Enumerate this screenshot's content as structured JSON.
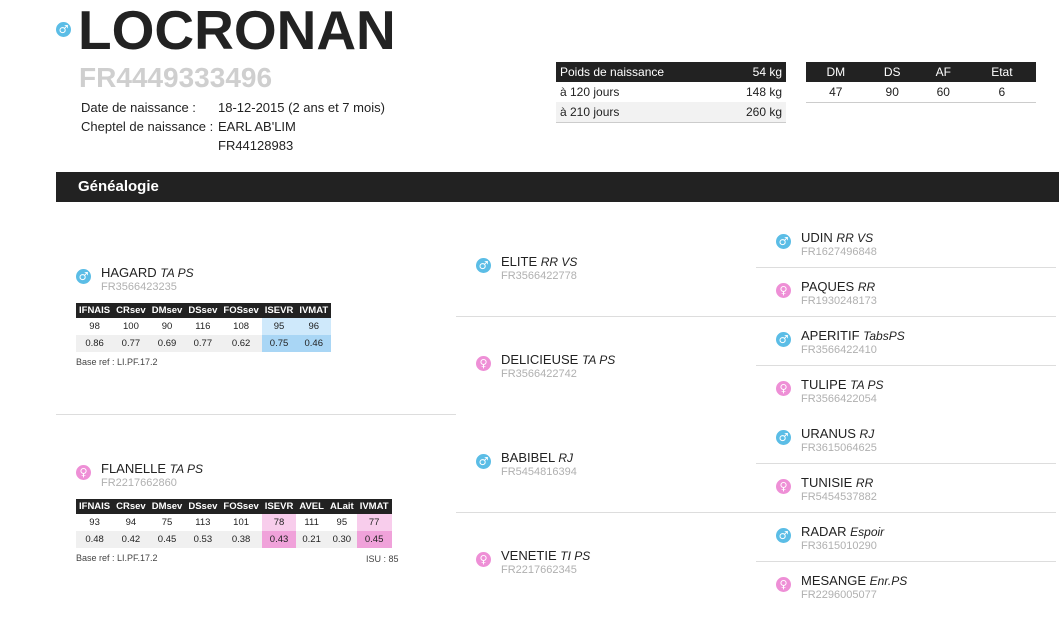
{
  "animal": {
    "sex_icon": "male-icon",
    "name": "LOCRONAN",
    "id": "FR4449333496",
    "birth_date_label": "Date de naissance :",
    "birth_date_value": "18-12-2015 (2 ans et 7 mois)",
    "birth_herd_label": "Cheptel de naissance :",
    "birth_herd_value": "EARL AB'LIM",
    "birth_herd_id": "FR44128983"
  },
  "weights": {
    "header_label": "Poids de naissance",
    "header_value": "54 kg",
    "rows": [
      {
        "label": "à 120 jours",
        "value": "148 kg"
      },
      {
        "label": "à 210 jours",
        "value": "260 kg"
      }
    ]
  },
  "scores": {
    "headers": [
      "DM",
      "DS",
      "AF",
      "Etat"
    ],
    "values": [
      "47",
      "90",
      "60",
      "6"
    ]
  },
  "section": {
    "title": "Généalogie"
  },
  "colors": {
    "male": "#5bbde6",
    "female": "#ee8fd6",
    "dark": "#222222"
  },
  "genealogy": {
    "sire": {
      "name": "HAGARD",
      "tag": "TA PS",
      "id": "FR3566423235",
      "icon": "male-icon",
      "index_headers": [
        "IFNAIS",
        "CRsev",
        "DMsev",
        "DSsev",
        "FOSsev",
        "ISEVR",
        "IVMAT"
      ],
      "index_values": [
        "98",
        "100",
        "90",
        "116",
        "108",
        "95",
        "96"
      ],
      "index_cd": [
        "0.86",
        "0.77",
        "0.69",
        "0.77",
        "0.62",
        "0.75",
        "0.46"
      ],
      "base_ref": "Base ref : LI.PF.17.2"
    },
    "dam": {
      "name": "FLANELLE",
      "tag": "TA PS",
      "id": "FR2217662860",
      "icon": "female-icon",
      "index_headers": [
        "IFNAIS",
        "CRsev",
        "DMsev",
        "DSsev",
        "FOSsev",
        "ISEVR",
        "AVEL",
        "ALait",
        "IVMAT"
      ],
      "index_values": [
        "93",
        "94",
        "75",
        "113",
        "101",
        "78",
        "111",
        "95",
        "77"
      ],
      "index_cd": [
        "0.48",
        "0.42",
        "0.45",
        "0.53",
        "0.38",
        "0.43",
        "0.21",
        "0.30",
        "0.45"
      ],
      "base_ref": "Base ref : LI.PF.17.2",
      "isu": "ISU : 85"
    },
    "grandparents": [
      {
        "name": "ELITE",
        "tag": "RR VS",
        "id": "FR3566422778",
        "icon": "male-icon"
      },
      {
        "name": "DELICIEUSE",
        "tag": "TA PS",
        "id": "FR3566422742",
        "icon": "female-icon"
      },
      {
        "name": "BABIBEL",
        "tag": "RJ",
        "id": "FR5454816394",
        "icon": "male-icon"
      },
      {
        "name": "VENETIE",
        "tag": "TI PS",
        "id": "FR2217662345",
        "icon": "female-icon"
      }
    ],
    "great_grandparents": [
      {
        "name": "UDIN",
        "tag": "RR VS",
        "id": "FR1627496848",
        "icon": "male-icon"
      },
      {
        "name": "PAQUES",
        "tag": "RR",
        "id": "FR1930248173",
        "icon": "female-icon"
      },
      {
        "name": "APERITIF",
        "tag": "TabsPS",
        "id": "FR3566422410",
        "icon": "male-icon"
      },
      {
        "name": "TULIPE",
        "tag": "TA PS",
        "id": "FR3566422054",
        "icon": "female-icon"
      },
      {
        "name": "URANUS",
        "tag": "RJ",
        "id": "FR3615064625",
        "icon": "male-icon"
      },
      {
        "name": "TUNISIE",
        "tag": "RR",
        "id": "FR5454537882",
        "icon": "female-icon"
      },
      {
        "name": "RADAR",
        "tag": "Espoir",
        "id": "FR3615010290",
        "icon": "male-icon"
      },
      {
        "name": "MESANGE",
        "tag": "Enr.PS",
        "id": "FR2296005077",
        "icon": "female-icon"
      }
    ]
  }
}
